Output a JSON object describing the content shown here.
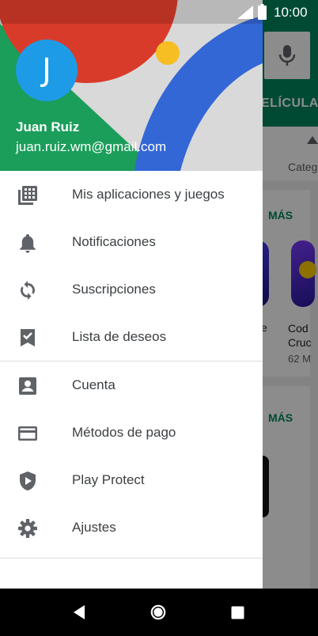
{
  "status_bar": {
    "time": "10:00"
  },
  "background_app": {
    "tab_label": "ELÍCULA",
    "categories_label": "Categ",
    "more_label_1": "MÁS",
    "more_label_2": "MÁS",
    "app_title_partial_1": "e",
    "app_title_partial_2_line1": "Cod",
    "app_title_partial_2_line2": "Cruc",
    "app_size_partial": "62 M"
  },
  "drawer": {
    "avatar_letter": "J",
    "user_name": "Juan Ruiz",
    "user_email": "juan.ruiz.wm@gmail.com",
    "section1": [
      {
        "label": "Mis aplicaciones y juegos",
        "icon": "apps-grid-icon"
      },
      {
        "label": "Notificaciones",
        "icon": "bell-icon"
      },
      {
        "label": "Suscripciones",
        "icon": "refresh-icon"
      },
      {
        "label": "Lista de deseos",
        "icon": "bookmark-check-icon"
      }
    ],
    "section2": [
      {
        "label": "Cuenta",
        "icon": "account-box-icon"
      },
      {
        "label": "Métodos de pago",
        "icon": "credit-card-icon"
      },
      {
        "label": "Play Protect",
        "icon": "shield-play-icon"
      },
      {
        "label": "Ajustes",
        "icon": "gear-icon"
      }
    ]
  },
  "colors": {
    "play_green": "#01875f",
    "avatar_blue": "#1e9be6",
    "icon_gray": "#5f6368",
    "text_dark": "#3c4043"
  }
}
